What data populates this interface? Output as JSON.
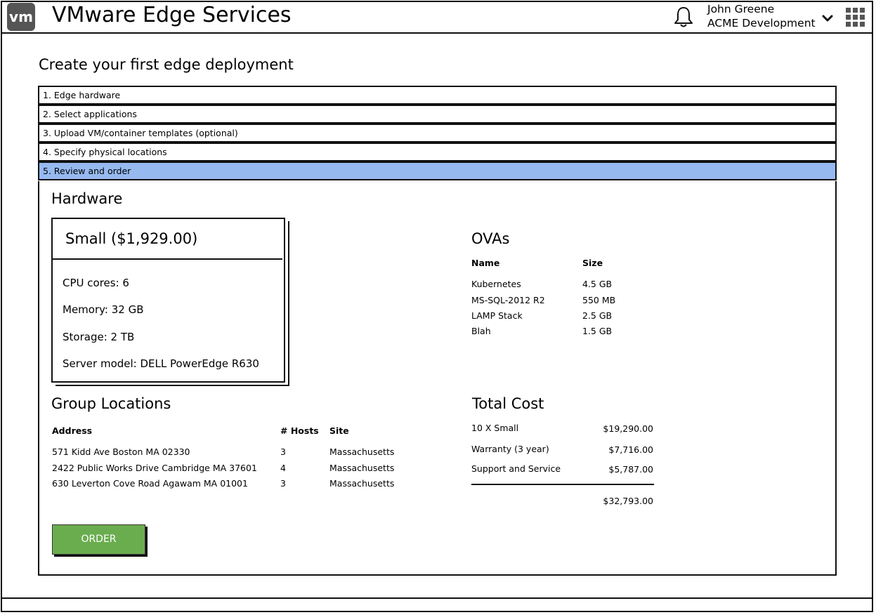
{
  "header": {
    "logo_text": "vm",
    "app_title": "VMware Edge Services",
    "user_name": "John Greene",
    "user_org": "ACME Development",
    "icons": [
      "bell-icon",
      "chevron-down-icon",
      "app-grid-icon"
    ]
  },
  "page_title": "Create your first edge deployment",
  "steps": [
    {
      "label": "1. Edge hardware",
      "active": false
    },
    {
      "label": "2. Select applications",
      "active": false
    },
    {
      "label": "3. Upload VM/container templates (optional)",
      "active": false
    },
    {
      "label": "4. Specify physical locations",
      "active": false
    },
    {
      "label": "5. Review and order",
      "active": true
    }
  ],
  "colors": {
    "active_step": "#96b9f0",
    "order_button": "#6aad4f"
  },
  "hardware": {
    "heading": "Hardware",
    "card_title": "Small ($1,929.00)",
    "specs": [
      "CPU cores: 6",
      "Memory: 32 GB",
      "Storage: 2 TB",
      "Server model: DELL PowerEdge R630"
    ]
  },
  "ovas": {
    "heading": "OVAs",
    "columns": [
      "Name",
      "Size"
    ],
    "rows": [
      [
        "Kubernetes",
        "4.5 GB"
      ],
      [
        "MS-SQL-2012 R2",
        "550 MB"
      ],
      [
        "LAMP Stack",
        "2.5 GB"
      ],
      [
        "Blah",
        "1.5 GB"
      ]
    ]
  },
  "locations": {
    "heading": "Group Locations",
    "columns": [
      "Address",
      "# Hosts",
      "Site"
    ],
    "rows": [
      [
        "571 Kidd Ave Boston MA 02330",
        "3",
        "Massachusetts"
      ],
      [
        "2422 Public Works Drive Cambridge MA 37601",
        "4",
        "Massachusetts"
      ],
      [
        "630 Leverton Cove Road Agawam MA 01001",
        "3",
        "Massachusetts"
      ]
    ]
  },
  "cost": {
    "heading": "Total Cost",
    "items": [
      [
        "10 X Small",
        "$19,290.00"
      ],
      [
        "Warranty (3 year)",
        "$7,716.00"
      ],
      [
        "Support and Service",
        "$5,787.00"
      ]
    ],
    "total": "$32,793.00"
  },
  "order_label": "ORDER"
}
